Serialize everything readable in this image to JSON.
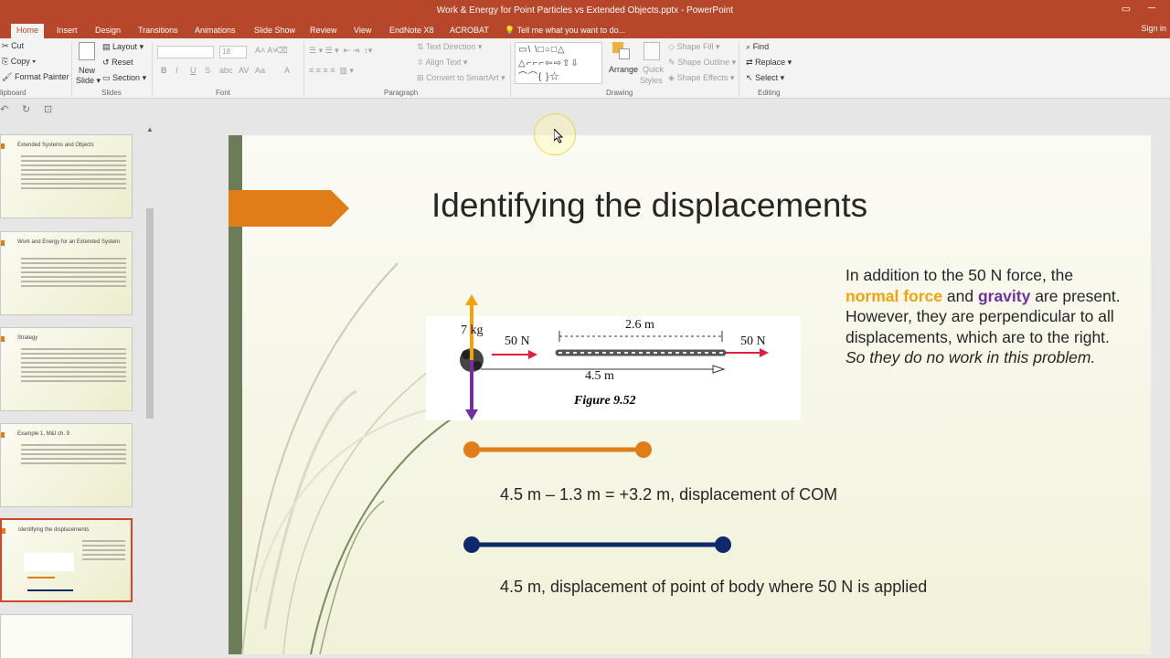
{
  "window": {
    "title": "Work & Energy for Point Particles vs Extended Objects.pptx - PowerPoint"
  },
  "tabs": [
    "Home",
    "Insert",
    "Design",
    "Transitions",
    "Animations",
    "Slide Show",
    "Review",
    "View",
    "EndNote X8",
    "ACROBAT"
  ],
  "tell_me": "Tell me what you want to do...",
  "sign_in": "Sign in",
  "ribbon": {
    "clipboard": {
      "cut": "Cut",
      "copy": "Copy",
      "format_painter": "Format Painter",
      "label": "lipboard"
    },
    "slides": {
      "new_slide": "New",
      "new_slide2": "Slide",
      "layout": "Layout",
      "reset": "Reset",
      "section": "Section",
      "label": "Slides"
    },
    "font": {
      "size": "18",
      "label": "Font"
    },
    "paragraph": {
      "text_direction": "Text Direction",
      "align_text": "Align Text",
      "convert": "Convert to SmartArt",
      "label": "Paragraph"
    },
    "drawing": {
      "arrange": "Arrange",
      "quick": "Quick",
      "styles": "Styles",
      "shape_fill": "Shape Fill",
      "shape_outline": "Shape Outline",
      "shape_effects": "Shape Effects",
      "label": "Drawing"
    },
    "editing": {
      "find": "Find",
      "replace": "Replace",
      "select": "Select",
      "label": "Editing"
    }
  },
  "thumbnails": [
    {
      "title": "Extended Systems and Objects"
    },
    {
      "title": "Work and Energy for an Extended System"
    },
    {
      "title": "Strategy"
    },
    {
      "title": "Example 1, M&I ch. 9"
    },
    {
      "title": "Identifying the displacements",
      "active": true
    }
  ],
  "slide": {
    "title": "Identifying the displacements",
    "body_pre": "In addition to the 50 N force, the ",
    "normal_force": "normal force",
    "and": " and ",
    "gravity": "gravity",
    "body_mid": " are present. However, they are perpendicular to all displacements, which are to the right. ",
    "body_italic": "So they do no work in this problem.",
    "figure": {
      "mass_label": "7 kg",
      "force_left": "50 N",
      "chain_length": "2.6 m",
      "force_right": "50 N",
      "distance": "4.5 m",
      "caption": "Figure 9.52"
    },
    "com_text": "4.5 m – 1.3 m = +3.2 m, displacement of COM",
    "point_text": "4.5 m, displacement of point of body where 50 N is applied"
  },
  "colors": {
    "accent_orange": "#e07d18",
    "dark_blue": "#0d2a6b",
    "purple": "#7030a0",
    "title_red": "#b7472a"
  }
}
